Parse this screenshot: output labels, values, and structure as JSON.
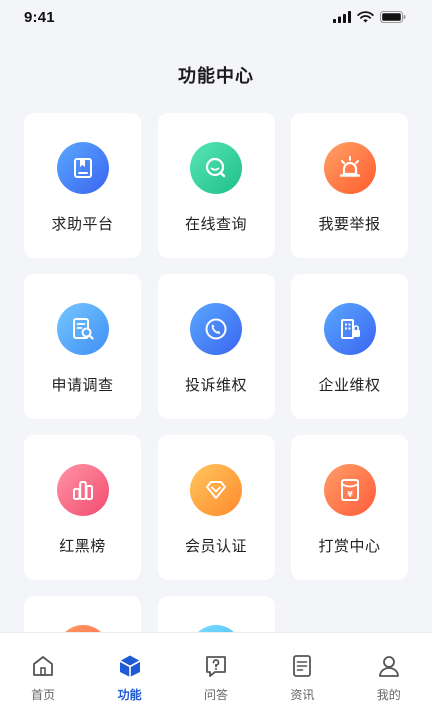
{
  "status_bar": {
    "time": "9:41"
  },
  "page": {
    "title": "功能中心"
  },
  "features": [
    {
      "label": "求助平台",
      "icon": "book-icon",
      "color": "#4f7df5"
    },
    {
      "label": "在线查询",
      "icon": "chat-search-icon",
      "color": "#2ccf9a"
    },
    {
      "label": "我要举报",
      "icon": "alarm-siren-icon",
      "color": "#ff6b3a"
    },
    {
      "label": "申请调查",
      "icon": "document-search-icon",
      "color": "#4f9cf8"
    },
    {
      "label": "投诉维权",
      "icon": "phone-complaint-icon",
      "color": "#4f7df5"
    },
    {
      "label": "企业维权",
      "icon": "building-lock-icon",
      "color": "#4f7df5"
    },
    {
      "label": "红黑榜",
      "icon": "ranking-bars-icon",
      "color": "#f25a7a"
    },
    {
      "label": "会员认证",
      "icon": "diamond-badge-icon",
      "color": "#ffa23e"
    },
    {
      "label": "打赏中心",
      "icon": "reward-envelope-icon",
      "color": "#ff6b3a"
    },
    {
      "label": "",
      "icon": "orange-icon",
      "color": "#ff7a45"
    },
    {
      "label": "",
      "icon": "cyan-icon",
      "color": "#5cc6f5"
    }
  ],
  "tab_bar": {
    "active": "功能",
    "tabs": [
      {
        "label": "首页",
        "icon": "home-icon"
      },
      {
        "label": "功能",
        "icon": "cube-icon"
      },
      {
        "label": "问答",
        "icon": "question-bubble-icon"
      },
      {
        "label": "资讯",
        "icon": "news-icon"
      },
      {
        "label": "我的",
        "icon": "profile-icon"
      }
    ]
  }
}
